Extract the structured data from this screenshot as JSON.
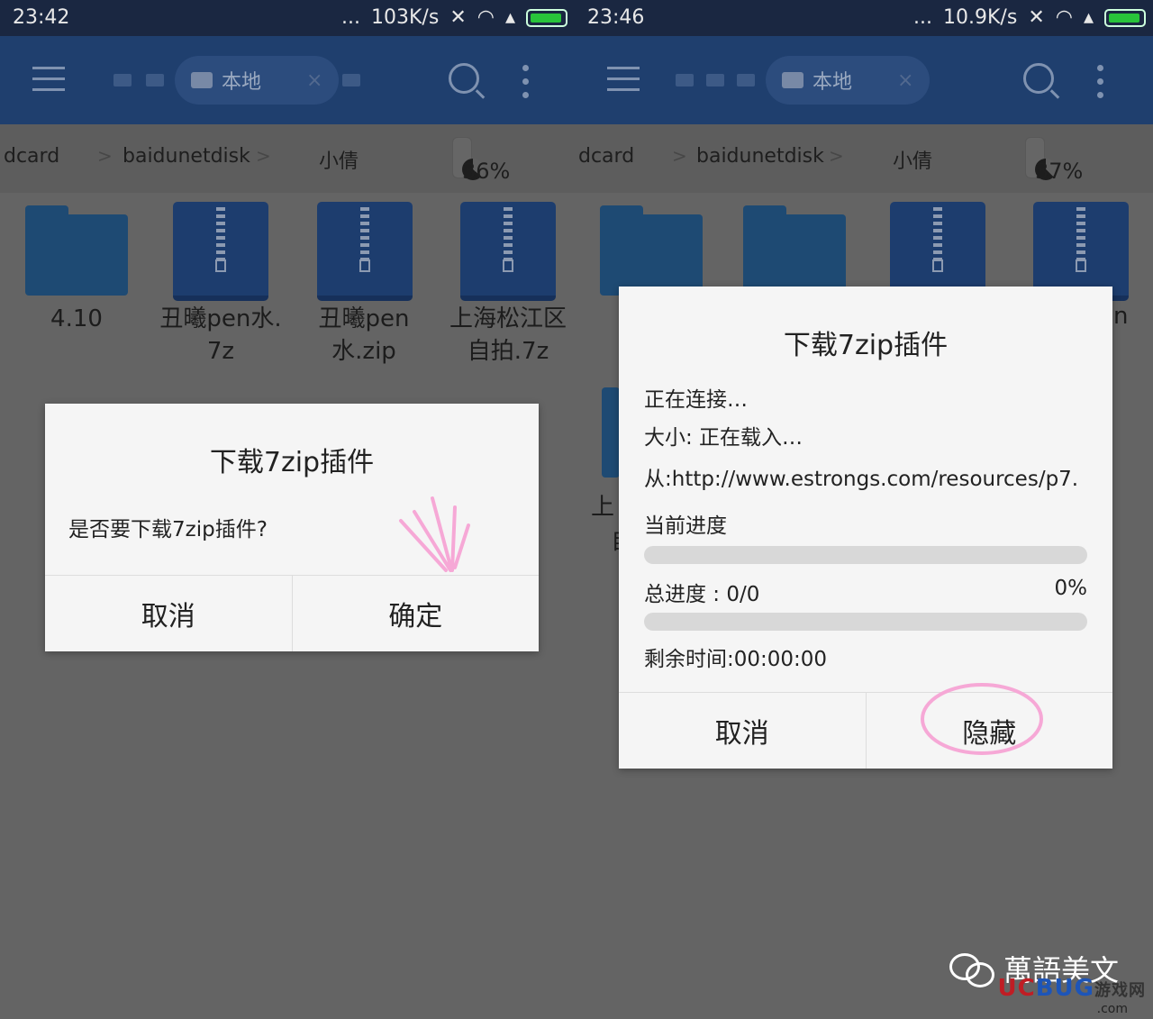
{
  "left": {
    "status": {
      "time": "23:42",
      "dots": "...",
      "speed": "103K/s"
    },
    "tab": {
      "label": "本地",
      "close": "×"
    },
    "breadcrumb": {
      "c1": "dcard",
      "c2": "baidunetdisk",
      "c3": "小倩",
      "sep": ">"
    },
    "storage": {
      "percent": "36%",
      "value": 0.36
    },
    "files": [
      {
        "name1": "4.10",
        "name2": ""
      },
      {
        "name1": "丑曦pen水.",
        "name2": "7z"
      },
      {
        "name1": "丑曦pen",
        "name2": "水.zip"
      },
      {
        "name1": "上海松江区",
        "name2": "自拍.7z"
      }
    ],
    "dialog": {
      "title": "下载7zip插件",
      "message": "是否要下载7zip插件?",
      "cancel": "取消",
      "ok": "确定"
    }
  },
  "right": {
    "status": {
      "time": "23:46",
      "dots": "...",
      "speed": "10.9K/s"
    },
    "tab": {
      "label": "本地",
      "close": "×"
    },
    "breadcrumb": {
      "c1": "dcard",
      "c2": "baidunetdisk",
      "c3": "小倩",
      "sep": ">"
    },
    "storage": {
      "percent": "37%",
      "value": 0.37
    },
    "partial_labels": {
      "a": "n",
      "b": "上",
      "c": "自"
    },
    "dialog": {
      "title": "下载7zip插件",
      "connecting": "正在连接…",
      "size": "大小: 正在载入…",
      "from": "从:http://www.estrongs.com/resources/p7.",
      "current_label": "当前进度",
      "current_value": 0,
      "total_label": "总进度 : 0/0",
      "total_pct": "0%",
      "total_value": 0,
      "remaining": "剩余时间:00:00:00",
      "cancel": "取消",
      "hide": "隐藏"
    }
  },
  "watermark": {
    "brand": "萬語美文",
    "site_uc": "UC",
    "site_bug": "BUG",
    "site_cn": "游戏网",
    "dotcom": ".com"
  }
}
